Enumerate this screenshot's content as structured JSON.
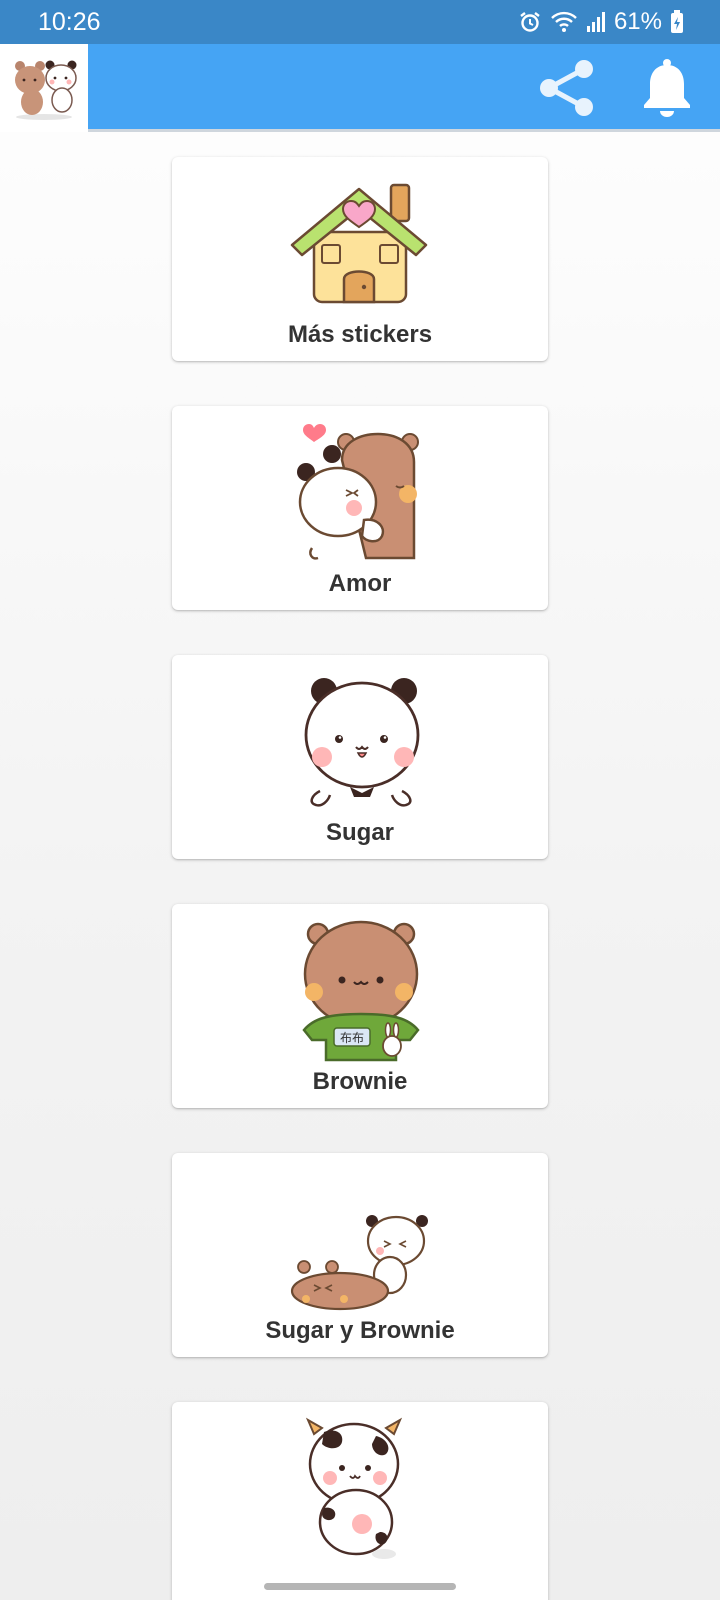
{
  "status_bar": {
    "time": "10:26",
    "battery": "61%",
    "icons": [
      "alarm-icon",
      "wifi-icon",
      "signal-icon",
      "battery-icon"
    ]
  },
  "app_bar": {
    "logo": "sugar-brownie-logo",
    "actions": [
      "share-icon",
      "bell-icon"
    ],
    "color": "#45a4f4",
    "status_color": "#3a87c7"
  },
  "categories": [
    {
      "label": "Más stickers",
      "image": "house-sticker"
    },
    {
      "label": "Amor",
      "image": "hug-sticker"
    },
    {
      "label": "Sugar",
      "image": "panda-sticker"
    },
    {
      "label": "Brownie",
      "image": "bear-sticker"
    },
    {
      "label": "Sugar y Brownie",
      "image": "duo-sticker"
    },
    {
      "label": "",
      "image": "cow-costume-sticker"
    }
  ]
}
